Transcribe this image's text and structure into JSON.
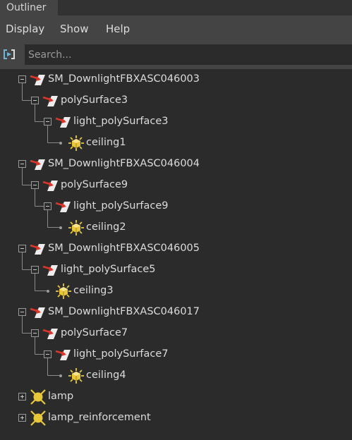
{
  "window": {
    "tab_title": "Outliner"
  },
  "menubar": {
    "items": [
      "Display",
      "Show",
      "Help"
    ]
  },
  "search": {
    "placeholder": "Search..."
  },
  "tree": [
    {
      "label": "SM_DownlightFBXASC046003",
      "icon": "transform-mesh-icon",
      "expanded": true,
      "children": [
        {
          "label": "polySurface3",
          "icon": "transform-mesh-icon",
          "expanded": true,
          "children": [
            {
              "label": "light_polySurface3",
              "icon": "transform-mesh-icon",
              "expanded": true,
              "children": [
                {
                  "label": "ceiling1",
                  "icon": "point-light-icon"
                }
              ]
            }
          ]
        }
      ]
    },
    {
      "label": "SM_DownlightFBXASC046004",
      "icon": "transform-mesh-icon",
      "expanded": true,
      "children": [
        {
          "label": "polySurface9",
          "icon": "transform-mesh-icon",
          "expanded": true,
          "children": [
            {
              "label": "light_polySurface9",
              "icon": "transform-mesh-icon",
              "expanded": true,
              "children": [
                {
                  "label": "ceiling2",
                  "icon": "point-light-icon"
                }
              ]
            }
          ]
        }
      ]
    },
    {
      "label": "SM_DownlightFBXASC046005",
      "icon": "transform-mesh-icon",
      "expanded": true,
      "children": [
        {
          "label": "light_polySurface5",
          "icon": "transform-mesh-icon",
          "expanded": true,
          "children": [
            {
              "label": "ceiling3",
              "icon": "point-light-icon"
            }
          ]
        }
      ]
    },
    {
      "label": "SM_DownlightFBXASC046017",
      "icon": "transform-mesh-icon",
      "expanded": true,
      "children": [
        {
          "label": "polySurface7",
          "icon": "transform-mesh-icon",
          "expanded": true,
          "children": [
            {
              "label": "light_polySurface7",
              "icon": "transform-mesh-icon",
              "expanded": true,
              "children": [
                {
                  "label": "ceiling4",
                  "icon": "point-light-icon"
                }
              ]
            }
          ]
        }
      ]
    },
    {
      "label": "lamp",
      "icon": "directional-light-icon",
      "expanded": false,
      "children": []
    },
    {
      "label": "lamp_reinforcement",
      "icon": "directional-light-icon",
      "expanded": false,
      "children": []
    }
  ],
  "colors": {
    "panel_bg": "#2b2b2b",
    "bar_bg": "#444444",
    "text": "#dcdcdc",
    "icon_red": "#d9372c",
    "icon_yellow": "#e8c83a"
  }
}
